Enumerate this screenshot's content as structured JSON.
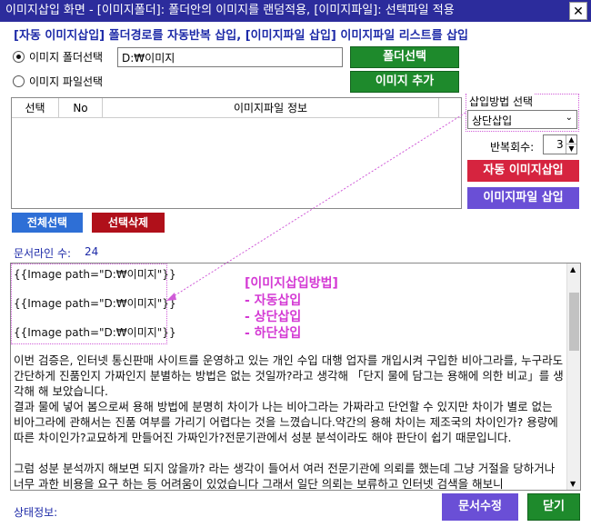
{
  "window": {
    "title": "이미지삽입 화면 - [이미지폴더]: 폴더안의 이미지를 랜덤적용, [이미지파일]: 선택파일 적용",
    "close_glyph": "✕"
  },
  "headline": "[자동 이미지삽입] 폴더경로를 자동반복 삽입, [이미지파일 삽입] 이미지파일 리스트를 삽입",
  "options": {
    "folder_label": "이미지 폴더선택",
    "file_label": "이미지 파일선택",
    "folder_path": "D:₩이미지",
    "folder_button": "폴더선택",
    "add_image_button": "이미지 추가"
  },
  "table": {
    "columns": [
      "선택",
      "No",
      "이미지파일 정보"
    ]
  },
  "insert_method": {
    "label": "삽입방법 선택",
    "selected": "상단삽입",
    "repeat_label": "반복회수:",
    "repeat_value": "3",
    "auto_insert_button": "자동 이미지삽입",
    "file_insert_button": "이미지파일 삽입"
  },
  "list_actions": {
    "select_all": "전체선택",
    "delete_selected": "선택삭제"
  },
  "doc": {
    "line_count_label": "문서라인 수:",
    "line_count_value": "24",
    "placeholders": [
      "{{Image path=\"D:₩이미지\"}}",
      "{{Image path=\"D:₩이미지\"}}",
      "{{Image path=\"D:₩이미지\"}}"
    ],
    "annotation": {
      "title": "[이미지삽입방법]",
      "items": [
        "- 자동삽입",
        "- 상단삽입",
        "- 하단삽입"
      ]
    },
    "paragraphs": [
      "이번 검증은, 인터넷 통신판매 사이트를 운영하고 있는 개인 수입 대행 업자를 개입시켜 구입한 비아그라를, 누구라도 간단하게 진품인지 가짜인지 분별하는 방법은 없는 것일까?라고 생각해 「단지 물에 담그는 용해에 의한 비교」를 생각해 해 보았습니다.",
      "결과 물에 넣어 봄으로써 용해 방법에 분명히 차이가 나는 비아그라는 가짜라고 단언할 수 있지만 차이가 별로 없는 비아그라에 관해서는 진품 여부를 가리기 어렵다는 것을 느꼈습니다.약간의 용해 차이는 제조국의 차이인가? 용량에 따른 차이인가?교묘하게 만들어진 가짜인가?전문기관에서 성분 분석이라도 해야 판단이 쉽기 때문입니다.",
      "",
      "그럼 성분 분석까지 해보면 되지 않을까? 라는 생각이 들어서 여러 전문기관에 의뢰를 했는데 그냥 거절을 당하거나 너무 과한 비용을 요구 하는 등 어려움이 있었습니다 그래서 일단 의뢰는 보류하고 인터넷 검색을 해보니"
    ]
  },
  "footer": {
    "status_label": "상태정보:",
    "edit_button": "문서수정",
    "close_button": "닫기"
  }
}
